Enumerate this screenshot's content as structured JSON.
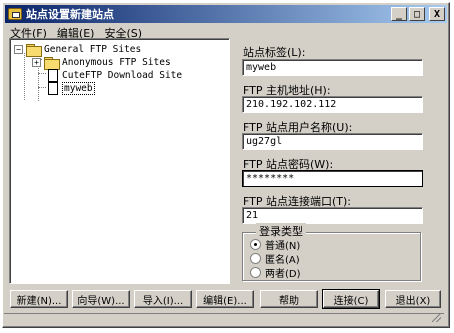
{
  "window": {
    "title": "站点设置新建站点",
    "minimize": "_",
    "maximize": "□",
    "close": "X"
  },
  "menu": [
    {
      "label": "文件",
      "key": "F"
    },
    {
      "label": "编辑",
      "key": "E"
    },
    {
      "label": "安全",
      "key": "S"
    }
  ],
  "tree": {
    "root": "General FTP Sites",
    "children": [
      "Anonymous FTP Sites",
      "CuteFTP Download Site",
      "myweb"
    ],
    "selected": "myweb"
  },
  "form": {
    "site_label": {
      "label": "站点标签(L):",
      "value": "myweb"
    },
    "host": {
      "label": "FTP 主机地址(H):",
      "value": "210.192.102.112"
    },
    "user": {
      "label": "FTP 站点用户名称(U):",
      "value": "ug27gl"
    },
    "password": {
      "label": "FTP 站点密码(W):",
      "value": "********"
    },
    "port": {
      "label": "FTP 站点连接端口(T):",
      "value": "21"
    },
    "login_type": {
      "title": "登录类型",
      "options": [
        "普通(N)",
        "匿名(A)",
        "两者(D)"
      ],
      "selected": "普通(N)"
    }
  },
  "buttons": {
    "new": "新建(N)...",
    "wizard": "向导(W)...",
    "import": "导入(I)...",
    "edit": "编辑(E)...",
    "help": "帮助",
    "connect": "连接(C)",
    "exit": "退出(X)"
  }
}
